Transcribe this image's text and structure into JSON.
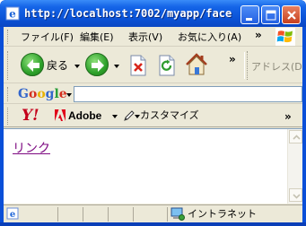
{
  "window": {
    "title": "http://localhost:7002/myapp/face..."
  },
  "menubar": {
    "items": [
      {
        "label": "ファイル(F)"
      },
      {
        "label": "編集(E)"
      },
      {
        "label": "表示(V)"
      },
      {
        "label": "お気に入り(A)"
      }
    ],
    "overflow": "»"
  },
  "toolbar": {
    "back_label": "戻る",
    "overflow": "»",
    "address_label": "アドレス(D)"
  },
  "google": {
    "logo_letters": [
      {
        "ch": "G",
        "color": "#3366cc"
      },
      {
        "ch": "o",
        "color": "#d52e1e"
      },
      {
        "ch": "o",
        "color": "#e7b100"
      },
      {
        "ch": "g",
        "color": "#3366cc"
      },
      {
        "ch": "l",
        "color": "#2a9e3a"
      },
      {
        "ch": "e",
        "color": "#d52e1e"
      }
    ],
    "search_value": "",
    "search_placeholder": ""
  },
  "links": {
    "yahoo_label": "Y!",
    "adobe_label": "Adobe",
    "customize_label": "カスタマイズ",
    "overflow": "»"
  },
  "content": {
    "link_text": "リンク"
  },
  "status": {
    "zone_label": "イントラネット"
  },
  "colors": {
    "titlebar": "#0a52d6",
    "link_visited": "#7e0b82",
    "chrome": "#ece9d8"
  }
}
